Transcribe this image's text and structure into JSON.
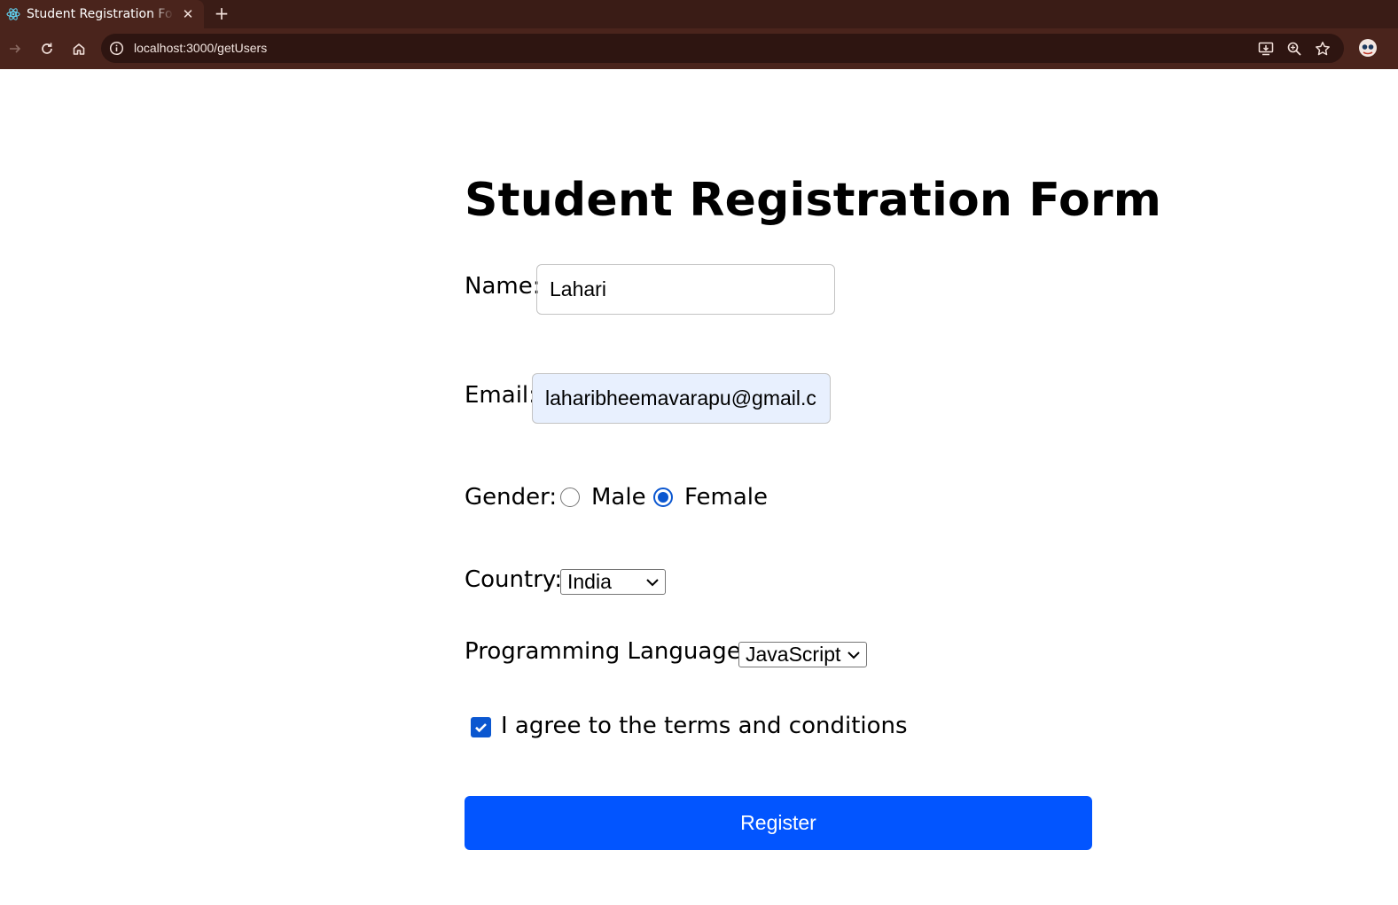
{
  "browser": {
    "tab_title": "Student Registration Form",
    "tab_close": "✕",
    "new_tab": "+",
    "url": "localhost:3000/getUsers"
  },
  "form": {
    "title": "Student Registration Form",
    "name_label": "Name:",
    "name_value": "Lahari",
    "email_label": "Email:",
    "email_value": "laharibheemavarapu@gmail.c",
    "gender_label": "Gender:",
    "gender_options": [
      "Male",
      "Female"
    ],
    "gender_selected": "Female",
    "country_label": "Country:",
    "country_value": "India",
    "language_label": "Programming Language:",
    "language_value": "JavaScript",
    "terms_label": "I agree to the terms and conditions",
    "terms_checked": true,
    "register_label": "Register"
  },
  "colors": {
    "chrome_dark": "#3a1c16",
    "chrome_toolbar": "#4a241c",
    "accent_blue": "#0b57d0",
    "button_blue": "#0255ff",
    "autofill_bg": "#e8f0fe"
  }
}
